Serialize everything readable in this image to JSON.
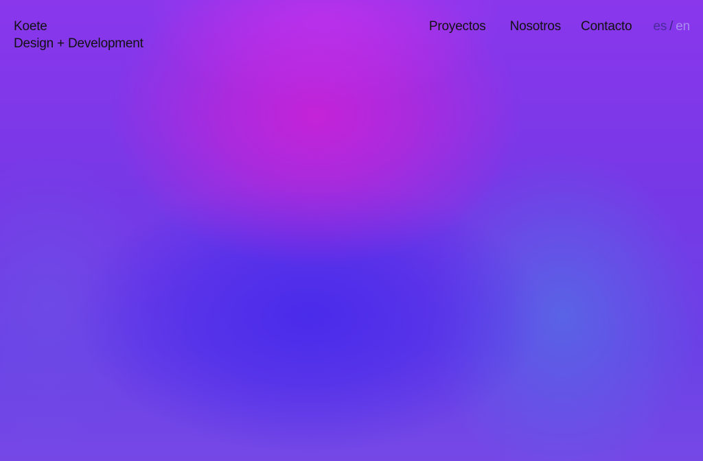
{
  "brand": {
    "name": "Koete",
    "tagline": "Design + Development"
  },
  "nav": {
    "items": [
      {
        "label": "Proyectos"
      },
      {
        "label": "Nosotros"
      },
      {
        "label": "Contacto"
      }
    ]
  },
  "language": {
    "es": "es",
    "separator": "/",
    "en": "en",
    "active": "es"
  },
  "colors": {
    "text": "#111111",
    "gradient_magenta": "#c822d7",
    "gradient_blue": "#482aeb",
    "gradient_violet": "#6e3ee6",
    "lang_inactive": "#a98cf0"
  }
}
